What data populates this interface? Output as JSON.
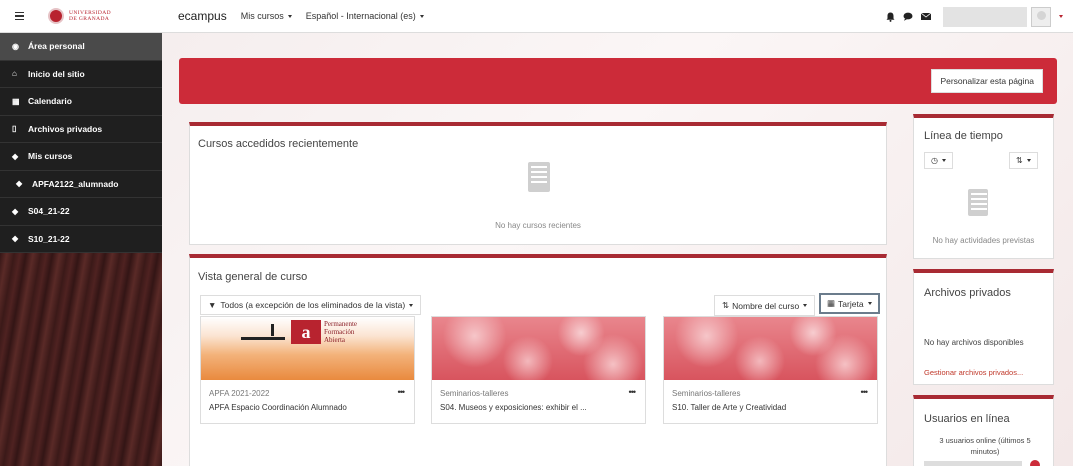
{
  "navbar": {
    "logo_text_line1": "UNIVERSIDAD",
    "logo_text_line2": "DE GRANADA",
    "brand": "ecampus",
    "my_courses": "Mis cursos",
    "language": "Español - Internacional (es)",
    "icons": [
      "bell-icon",
      "chat-icon",
      "envelope-icon"
    ]
  },
  "sidebar": {
    "items": [
      {
        "label": "Área personal",
        "icon": "dashboard-icon"
      },
      {
        "label": "Inicio del sitio",
        "icon": "home-icon"
      },
      {
        "label": "Calendario",
        "icon": "calendar-icon"
      },
      {
        "label": "Archivos privados",
        "icon": "file-icon"
      },
      {
        "label": "Mis cursos",
        "icon": "graduation-cap-icon"
      },
      {
        "label": "APFA2122_alumnado",
        "icon": "graduation-cap-icon"
      },
      {
        "label": "S04_21-22",
        "icon": "graduation-cap-icon"
      },
      {
        "label": "S10_21-22",
        "icon": "graduation-cap-icon"
      }
    ]
  },
  "header": {
    "customize_button": "Personalizar esta página"
  },
  "recent": {
    "title": "Cursos accedidos recientemente",
    "empty": "No hay cursos recientes"
  },
  "overview": {
    "title": "Vista general de curso",
    "filter": "Todos (a excepción de los eliminados de la vista)",
    "sort": "Nombre del curso",
    "view": "Tarjeta",
    "courses": [
      {
        "category": "APFA 2021-2022",
        "name": "APFA Espacio Coordinación Alumnado",
        "logo_words": [
          "Permanente",
          "Formación",
          "Abierta"
        ]
      },
      {
        "category": "Seminarios-talleres",
        "name": "S04. Museos y exposiciones: exhibir el ..."
      },
      {
        "category": "Seminarios-talleres",
        "name": "S10. Taller de Arte y Creatividad"
      }
    ]
  },
  "timeline": {
    "title": "Línea de tiempo",
    "empty": "No hay actividades previstas"
  },
  "private_files": {
    "title": "Archivos privados",
    "empty": "No hay archivos disponibles",
    "manage_link": "Gestionar archivos privados..."
  },
  "online_users": {
    "title": "Usuarios en línea",
    "count_text": "3 usuarios online (últimos 5 minutos)"
  },
  "colors": {
    "accent": "#cc2b39",
    "sidebar_bg": "#1f1f1f"
  }
}
